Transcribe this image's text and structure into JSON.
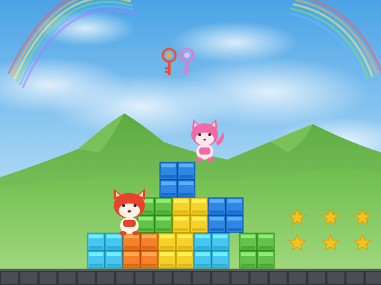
{
  "game": {
    "palette": {
      "sky_top": "#4fa6e8",
      "sky_bottom": "#cfe9fb",
      "hill_light": "#8fd06a",
      "hill_dark": "#4e9e3a",
      "ground": "#3d3f44",
      "cyan": "#47c7ef",
      "orange": "#f5822a",
      "yellow": "#f7d12b",
      "green": "#63c24a",
      "blue": "#2f86e3",
      "star": "#f6c31c",
      "key_orange": "#f0624a",
      "key_pink": "#e97fd6",
      "fox_red": "#e8432c",
      "fox_pink": "#f06aa6"
    },
    "keys": [
      {
        "color": "key_orange",
        "icon": "key-icon"
      },
      {
        "color": "key_pink",
        "icon": "key-icon"
      }
    ],
    "stars": {
      "count": 6,
      "collected": 0,
      "icon": "star-icon"
    },
    "characters": [
      {
        "name": "red-fox-character",
        "color": "fox_red"
      },
      {
        "name": "pink-fox-character",
        "color": "fox_pink"
      }
    ]
  }
}
